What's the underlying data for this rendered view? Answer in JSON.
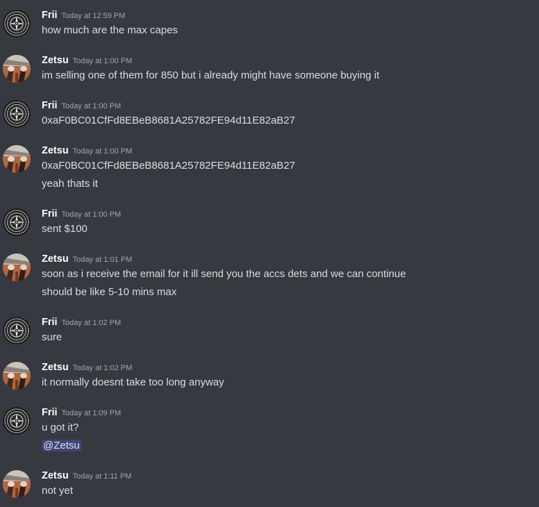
{
  "users": {
    "frii": {
      "name": "Frii",
      "avatar_icon": "compass-medallion-avatar"
    },
    "zetsu": {
      "name": "Zetsu",
      "avatar_icon": "rooftop-photo-avatar"
    }
  },
  "messages": [
    {
      "author": "Frii",
      "time": "Today at 12:59 PM",
      "lines": [
        "how much are the max capes"
      ]
    },
    {
      "author": "Zetsu",
      "time": "Today at 1:00 PM",
      "lines": [
        "im selling one of them for 850 but i already might have someone buying it"
      ]
    },
    {
      "author": "Frii",
      "time": "Today at 1:00 PM",
      "lines": [
        "0xaF0BC01CfFd8EBeB8681A25782FE94d11E82aB27"
      ]
    },
    {
      "author": "Zetsu",
      "time": "Today at 1:00 PM",
      "lines": [
        "0xaF0BC01CfFd8EBeB8681A25782FE94d11E82aB27",
        "yeah thats it"
      ]
    },
    {
      "author": "Frii",
      "time": "Today at 1:00 PM",
      "lines": [
        "sent $100"
      ]
    },
    {
      "author": "Zetsu",
      "time": "Today at 1:01 PM",
      "lines": [
        "soon as i receive the email for it ill send you the accs dets and we can continue",
        "should be like 5-10 mins max"
      ]
    },
    {
      "author": "Frii",
      "time": "Today at 1:02 PM",
      "lines": [
        "sure"
      ]
    },
    {
      "author": "Zetsu",
      "time": "Today at 1:02 PM",
      "lines": [
        "it normally doesnt take too long anyway"
      ]
    },
    {
      "author": "Frii",
      "time": "Today at 1:09 PM",
      "lines": [
        "u got it?"
      ],
      "mention": "@Zetsu"
    },
    {
      "author": "Zetsu",
      "time": "Today at 1:11 PM",
      "lines": [
        "not yet"
      ]
    }
  ],
  "colors": {
    "background": "#36393f",
    "username": "#ffffff",
    "timestamp": "#a3a6aa",
    "text": "#dcddde",
    "mention_bg": "#4a4f7a",
    "mention_text": "#dee0fc"
  }
}
